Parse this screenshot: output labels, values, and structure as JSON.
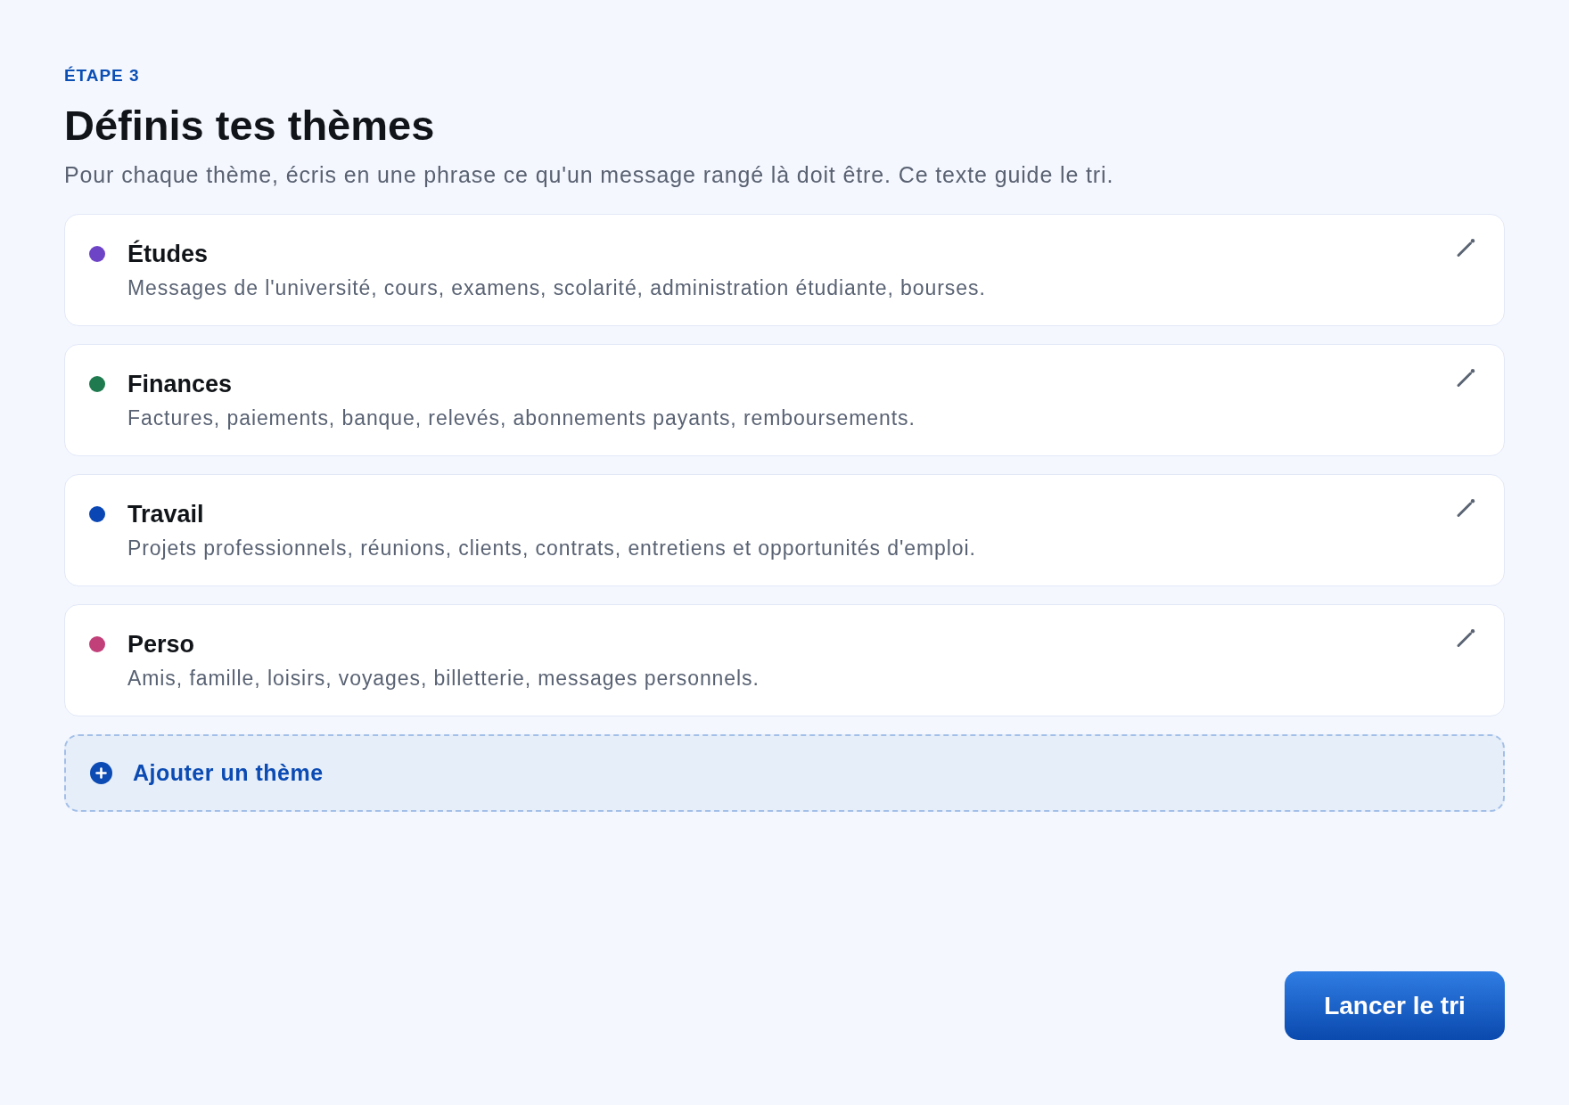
{
  "header": {
    "step": "ÉTAPE 3",
    "title": "Définis tes thèmes",
    "subtitle": "Pour chaque thème, écris en une phrase ce qu'un message rangé là doit être. Ce texte guide le tri."
  },
  "themes": [
    {
      "name": "Études",
      "description": "Messages de l'université, cours, examens, scolarité, administration étudiante, bourses.",
      "color": "#6e44c6"
    },
    {
      "name": "Finances",
      "description": "Factures, paiements, banque, relevés, abonnements payants, remboursements.",
      "color": "#1f7a4f"
    },
    {
      "name": "Travail",
      "description": "Projets professionnels, réunions, clients, contrats, entretiens et opportunités d'emploi.",
      "color": "#0a47b5"
    },
    {
      "name": "Perso",
      "description": "Amis, famille, loisirs, voyages, billetterie, messages personnels.",
      "color": "#c2407a"
    }
  ],
  "add_button": {
    "label": "Ajouter un thème"
  },
  "primary_button": {
    "label": "Lancer le tri"
  }
}
